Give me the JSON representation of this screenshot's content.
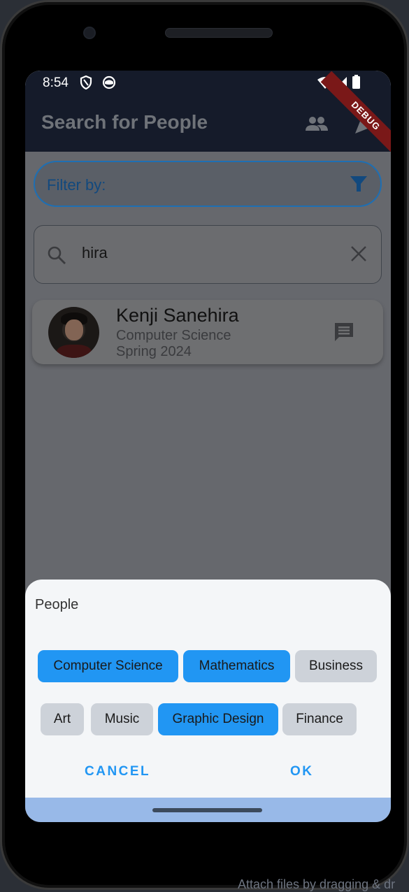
{
  "status_bar": {
    "time": "8:54",
    "icons": [
      "shield-icon",
      "cat-face-icon",
      "wifi-icon",
      "cellular-signal-icon",
      "battery-icon"
    ]
  },
  "debug_banner": "DEBUG",
  "app_bar": {
    "title": "Search for People",
    "actions": [
      "people-icon",
      "party-popper-icon"
    ]
  },
  "filter": {
    "label": "Filter by:",
    "icon": "filter-icon",
    "accent_color": "#1e6fb3"
  },
  "search": {
    "value": "hira",
    "icon": "search-icon",
    "clear_icon": "close-icon"
  },
  "results": [
    {
      "name": "Kenji Sanehira",
      "major": "Computer Science",
      "term": "Spring 2024",
      "action_icon": "message-icon"
    }
  ],
  "dialog": {
    "title": "People",
    "chips": [
      {
        "label": "Computer Science",
        "selected": true
      },
      {
        "label": "Mathematics",
        "selected": true
      },
      {
        "label": "Business",
        "selected": false
      },
      {
        "label": "Art",
        "selected": false
      },
      {
        "label": "Music",
        "selected": false
      },
      {
        "label": "Graphic Design",
        "selected": true
      },
      {
        "label": "Finance",
        "selected": false
      }
    ],
    "cancel_label": "CANCEL",
    "ok_label": "OK",
    "selected_color": "#2196f3",
    "unselected_color": "#cdd2d9"
  },
  "background_text": "Attach files by dragging & dr"
}
